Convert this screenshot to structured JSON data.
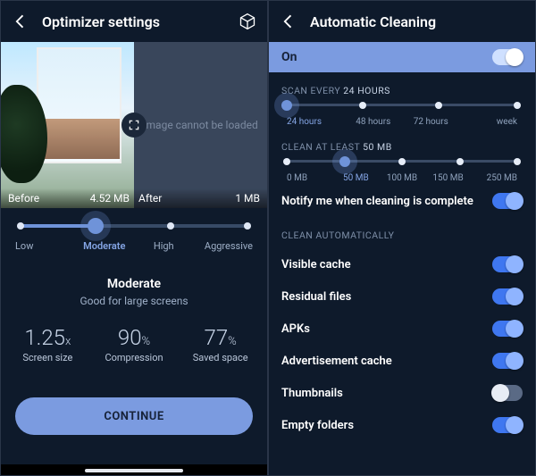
{
  "left": {
    "title": "Optimizer settings",
    "compare": {
      "before_label": "Before",
      "before_size": "4.52 MB",
      "after_label": "After",
      "after_size": "1 MB",
      "after_error": "Image cannot be loaded"
    },
    "quality": {
      "options": [
        "Low",
        "Moderate",
        "High",
        "Aggressive"
      ],
      "selected_index": 1,
      "heading": "Moderate",
      "sub": "Good for large screens"
    },
    "stats": {
      "screen_size": {
        "value": "1.25",
        "unit": "x",
        "label": "Screen size"
      },
      "compression": {
        "value": "90",
        "unit": "%",
        "label": "Compression"
      },
      "saved": {
        "value": "77",
        "unit": "%",
        "label": "Saved space"
      }
    },
    "cta": "CONTINUE"
  },
  "right": {
    "title": "Automatic Cleaning",
    "on_label": "On",
    "scan": {
      "header_prefix": "SCAN EVERY ",
      "header_value": "24 HOURS",
      "options": [
        "24 hours",
        "48 hours",
        "72 hours",
        "week"
      ],
      "selected_index": 0
    },
    "clean_min": {
      "header_prefix": "CLEAN AT LEAST ",
      "header_value": "50 MB",
      "options": [
        "0 MB",
        "50 MB",
        "100 MB",
        "150 MB",
        "250 MB"
      ],
      "selected_index": 1
    },
    "notify_label": "Notify me when cleaning is complete",
    "auto_header": "CLEAN AUTOMATICALLY",
    "items": [
      {
        "label": "Visible cache",
        "on": true
      },
      {
        "label": "Residual files",
        "on": true
      },
      {
        "label": "APKs",
        "on": true
      },
      {
        "label": "Advertisement cache",
        "on": true
      },
      {
        "label": "Thumbnails",
        "on": false
      },
      {
        "label": "Empty folders",
        "on": true
      }
    ]
  }
}
